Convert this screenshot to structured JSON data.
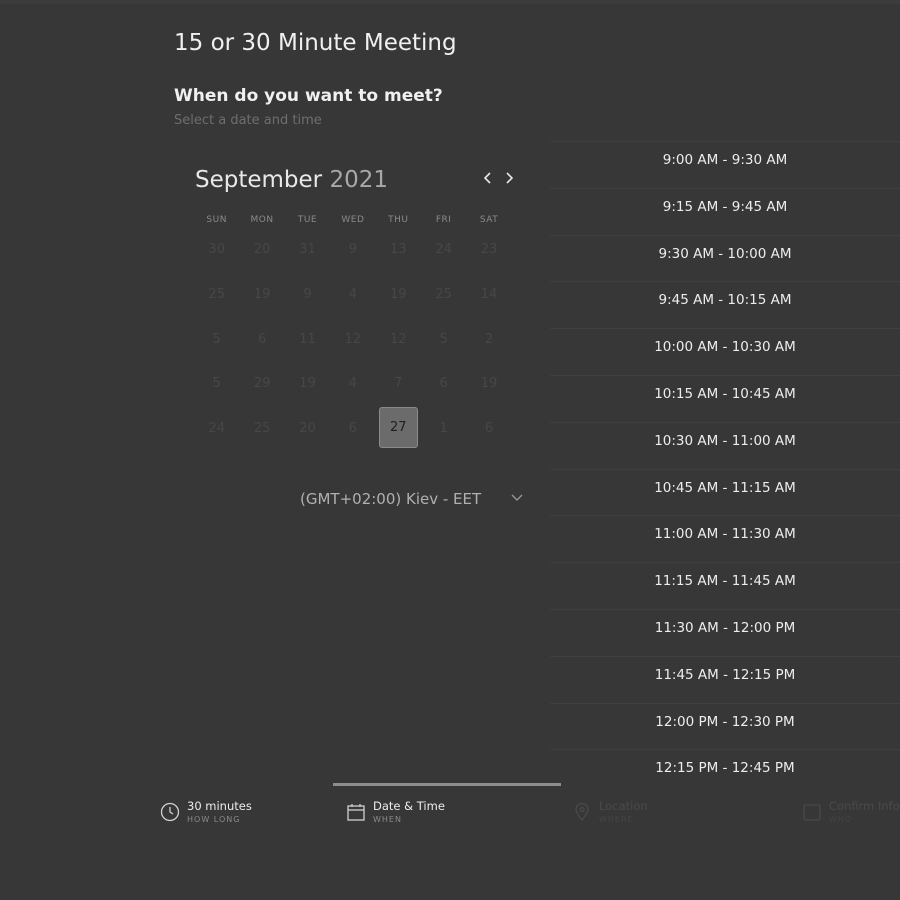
{
  "meeting_title": "15 or 30 Minute Meeting",
  "heading": "When do you want to meet?",
  "subheading": "Select a date and time",
  "calendar": {
    "month": "September",
    "year": "2021",
    "weekdays": [
      "SUN",
      "MON",
      "TUE",
      "WED",
      "THU",
      "FRI",
      "SAT"
    ],
    "weeks": [
      [
        "30",
        "20",
        "31",
        "9",
        "13",
        "24",
        "23"
      ],
      [
        "25",
        "19",
        "9",
        "4",
        "19",
        "25",
        "14"
      ],
      [
        "5",
        "6",
        "11",
        "12",
        "12",
        "5",
        "2"
      ],
      [
        "5",
        "29",
        "19",
        "4",
        "7",
        "6",
        "19"
      ],
      [
        "24",
        "25",
        "20",
        "6",
        "27",
        "1",
        "6"
      ]
    ],
    "selected_day": "27"
  },
  "timezone": "(GMT+02:00) Kiev - EET",
  "time_slots": [
    "9:00 AM - 9:30 AM",
    "9:15 AM - 9:45 AM",
    "9:30 AM - 10:00 AM",
    "9:45 AM - 10:15 AM",
    "10:00 AM - 10:30 AM",
    "10:15 AM - 10:45 AM",
    "10:30 AM - 11:00 AM",
    "10:45 AM - 11:15 AM",
    "11:00 AM - 11:30 AM",
    "11:15 AM - 11:45 AM",
    "11:30 AM - 12:00 PM",
    "11:45 AM - 12:15 PM",
    "12:00 PM - 12:30 PM",
    "12:15 PM - 12:45 PM"
  ],
  "steps": [
    {
      "label": "30 minutes",
      "sub": "HOW LONG",
      "icon": "clock-icon",
      "active": true
    },
    {
      "label": "Date & Time",
      "sub": "WHEN",
      "icon": "calendar-icon",
      "active": true
    },
    {
      "label": "Location",
      "sub": "WHERE",
      "icon": "location-pin-icon",
      "active": false
    },
    {
      "label": "Confirm Info",
      "sub": "WHO",
      "icon": "card-icon",
      "active": false
    }
  ],
  "colors": {
    "background": "#373737",
    "selected_day": "#6b6b6b",
    "active_step_line": "#8d8d8d"
  }
}
